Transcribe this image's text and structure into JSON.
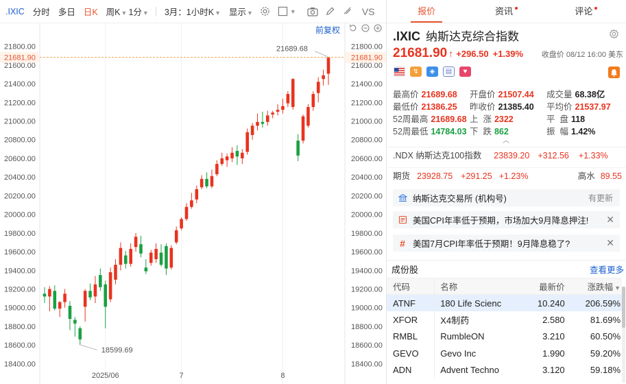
{
  "toolbar": {
    "symbol": ".IXIC",
    "items": [
      "分时",
      "多日",
      "日K",
      "周K",
      "1分",
      "3月：1小时K",
      "显示"
    ],
    "active": "日K"
  },
  "chart": {
    "fuquan_label": "前复权",
    "last_price_label": "21681.90",
    "y_ticks": [
      "21800.00",
      "21600.00",
      "21400.00",
      "21200.00",
      "21000.00",
      "20800.00",
      "20600.00",
      "20400.00",
      "20200.00",
      "20000.00",
      "19800.00",
      "19600.00",
      "19400.00",
      "19200.00",
      "19000.00",
      "18800.00",
      "18600.00",
      "18400.00"
    ],
    "x_ticks": [
      "2025/06",
      "7",
      "8"
    ],
    "high_annotation": "21689.68",
    "low_annotation": "18599.69"
  },
  "chart_data": {
    "type": "candlestick",
    "last_price": 21681.9,
    "high": 21689.68,
    "low": 18599.69,
    "ylim": [
      18300,
      21900
    ],
    "colors": {
      "up": "#e8331f",
      "down": "#1aa043"
    },
    "candles": [
      {
        "o": 19150,
        "h": 19220,
        "l": 19050,
        "c": 19120
      },
      {
        "o": 19120,
        "h": 19230,
        "l": 18960,
        "c": 19200
      },
      {
        "o": 19180,
        "h": 19240,
        "l": 18970,
        "c": 18990
      },
      {
        "o": 18990,
        "h": 19070,
        "l": 18900,
        "c": 19060
      },
      {
        "o": 19060,
        "h": 19200,
        "l": 19000,
        "c": 19150
      },
      {
        "o": 19020,
        "h": 19070,
        "l": 18760,
        "c": 18880
      },
      {
        "o": 18870,
        "h": 18900,
        "l": 18690,
        "c": 18830
      },
      {
        "o": 18780,
        "h": 18800,
        "l": 18599.69,
        "c": 18660
      },
      {
        "o": 19010,
        "h": 19200,
        "l": 18850,
        "c": 19180
      },
      {
        "o": 19180,
        "h": 19260,
        "l": 19080,
        "c": 19110
      },
      {
        "o": 19120,
        "h": 19340,
        "l": 19050,
        "c": 19250
      },
      {
        "o": 19350,
        "h": 19420,
        "l": 19180,
        "c": 19220
      },
      {
        "o": 19250,
        "h": 19290,
        "l": 18780,
        "c": 19010
      },
      {
        "o": 19090,
        "h": 19430,
        "l": 19060,
        "c": 19380
      },
      {
        "o": 19300,
        "h": 19520,
        "l": 19250,
        "c": 19460
      },
      {
        "o": 19460,
        "h": 19700,
        "l": 19400,
        "c": 19640
      },
      {
        "o": 19560,
        "h": 19610,
        "l": 19420,
        "c": 19470
      },
      {
        "o": 19470,
        "h": 19690,
        "l": 19440,
        "c": 19630
      },
      {
        "o": 19650,
        "h": 19800,
        "l": 19600,
        "c": 19760
      },
      {
        "o": 19680,
        "h": 19770,
        "l": 19540,
        "c": 19580
      },
      {
        "o": 19430,
        "h": 19520,
        "l": 19360,
        "c": 19390
      },
      {
        "o": 19480,
        "h": 19620,
        "l": 19450,
        "c": 19590
      },
      {
        "o": 19520,
        "h": 19690,
        "l": 19480,
        "c": 19630
      },
      {
        "o": 19590,
        "h": 19680,
        "l": 19440,
        "c": 19460
      },
      {
        "o": 19660,
        "h": 19690,
        "l": 19350,
        "c": 19420
      },
      {
        "o": 19430,
        "h": 19670,
        "l": 19410,
        "c": 19640
      },
      {
        "o": 19700,
        "h": 19870,
        "l": 19680,
        "c": 19830
      },
      {
        "o": 19850,
        "h": 19970,
        "l": 19830,
        "c": 19950
      },
      {
        "o": 19950,
        "h": 20120,
        "l": 19930,
        "c": 20080
      },
      {
        "o": 20080,
        "h": 20230,
        "l": 20060,
        "c": 20150
      },
      {
        "o": 20160,
        "h": 20310,
        "l": 20120,
        "c": 20270
      },
      {
        "o": 20290,
        "h": 20420,
        "l": 20270,
        "c": 20380
      },
      {
        "o": 20380,
        "h": 20450,
        "l": 20280,
        "c": 20300
      },
      {
        "o": 20300,
        "h": 20480,
        "l": 20280,
        "c": 20410
      },
      {
        "o": 20430,
        "h": 20580,
        "l": 20410,
        "c": 20540
      },
      {
        "o": 20540,
        "h": 20660,
        "l": 20520,
        "c": 20600
      },
      {
        "o": 20580,
        "h": 20650,
        "l": 20510,
        "c": 20620
      },
      {
        "o": 20600,
        "h": 20720,
        "l": 20560,
        "c": 20660
      },
      {
        "o": 20680,
        "h": 20740,
        "l": 20530,
        "c": 20620
      },
      {
        "o": 20600,
        "h": 20700,
        "l": 20540,
        "c": 20660
      },
      {
        "o": 20670,
        "h": 20920,
        "l": 20640,
        "c": 20880
      },
      {
        "o": 20850,
        "h": 20980,
        "l": 20800,
        "c": 20950
      },
      {
        "o": 20950,
        "h": 21080,
        "l": 20900,
        "c": 20990
      },
      {
        "o": 20990,
        "h": 21100,
        "l": 20930,
        "c": 20970
      },
      {
        "o": 20990,
        "h": 21110,
        "l": 20950,
        "c": 21060
      },
      {
        "o": 21070,
        "h": 21110,
        "l": 21030,
        "c": 21090
      },
      {
        "o": 21100,
        "h": 21180,
        "l": 21060,
        "c": 21120
      },
      {
        "o": 21120,
        "h": 21240,
        "l": 21080,
        "c": 21160
      },
      {
        "o": 21190,
        "h": 21320,
        "l": 21150,
        "c": 21290
      },
      {
        "o": 21150,
        "h": 21460,
        "l": 21120,
        "c": 21450
      },
      {
        "o": 20790,
        "h": 20860,
        "l": 20570,
        "c": 20630
      },
      {
        "o": 20790,
        "h": 21070,
        "l": 20760,
        "c": 21050
      },
      {
        "o": 20950,
        "h": 21180,
        "l": 20930,
        "c": 21150
      },
      {
        "o": 21150,
        "h": 21320,
        "l": 21110,
        "c": 21290
      },
      {
        "o": 21300,
        "h": 21470,
        "l": 21200,
        "c": 21420
      },
      {
        "o": 21450,
        "h": 21550,
        "l": 21380,
        "c": 21490
      },
      {
        "o": 21507.44,
        "h": 21689.68,
        "l": 21386.25,
        "c": 21681.9
      }
    ]
  },
  "quote": {
    "symbol": ".IXIC",
    "name": "纳斯达克综合指数",
    "price": "21681.90",
    "change": "+296.50",
    "pct": "+1.39%",
    "close_info": "收盘价 08/12 16:00 美东"
  },
  "tabs": [
    {
      "label": "报价",
      "dot": false
    },
    {
      "label": "资讯",
      "dot": true
    },
    {
      "label": "评论",
      "dot": true
    }
  ],
  "stats": [
    [
      {
        "l": "最高价",
        "v": "21689.68",
        "c": "red"
      },
      {
        "l": "开盘价",
        "v": "21507.44",
        "c": "red"
      },
      {
        "l": "成交量",
        "v": "68.38亿",
        "c": "dark"
      }
    ],
    [
      {
        "l": "最低价",
        "v": "21386.25",
        "c": "red"
      },
      {
        "l": "昨收价",
        "v": "21385.40",
        "c": "dark"
      },
      {
        "l": "平均价",
        "v": "21537.97",
        "c": "red"
      }
    ],
    [
      {
        "l": "52周最高",
        "v": "21689.68",
        "c": "red"
      },
      {
        "l": "上  涨",
        "v": "2322",
        "c": "red"
      },
      {
        "l": "平  盘",
        "v": "118",
        "c": "dark"
      }
    ],
    [
      {
        "l": "52周最低",
        "v": "14784.03",
        "c": "green"
      },
      {
        "l": "下  跌",
        "v": "862",
        "c": "green"
      },
      {
        "l": "振  幅",
        "v": "1.42%",
        "c": "dark"
      }
    ]
  ],
  "ndx": {
    "name": ".NDX 纳斯达克100指数",
    "price": "23839.20",
    "change": "+312.56",
    "pct": "+1.33%"
  },
  "futures": {
    "label": "期货",
    "price": "23928.75",
    "change": "+291.25",
    "pct": "+1.23%",
    "hw_label": "高水",
    "hw_value": "89.55"
  },
  "news": [
    {
      "text": "纳斯达克交易所 (机构号)",
      "more": "有更新",
      "icon": "building-icon"
    },
    {
      "text": "美国CPI年率低于预期，市场加大9月降息押注!",
      "icon": "news-icon"
    },
    {
      "text": "美国7月CPI年率低于预期！9月降息稳了?",
      "icon": "hash-icon"
    }
  ],
  "constituents": {
    "title": "成份股",
    "more": "查看更多",
    "headers": [
      "代码",
      "名称",
      "最新价",
      "涨跌幅"
    ],
    "rows": [
      {
        "code": "ATNF",
        "name": "180 Life Scienc",
        "price": "10.240",
        "pct": "206.59%"
      },
      {
        "code": "XFOR",
        "name": "X4制药",
        "price": "2.580",
        "pct": "81.69%"
      },
      {
        "code": "RMBL",
        "name": "RumbleON",
        "price": "3.210",
        "pct": "60.50%"
      },
      {
        "code": "GEVO",
        "name": "Gevo Inc",
        "price": "1.990",
        "pct": "59.20%"
      },
      {
        "code": "ADN",
        "name": "Advent Techno",
        "price": "3.120",
        "pct": "59.18%"
      }
    ]
  }
}
